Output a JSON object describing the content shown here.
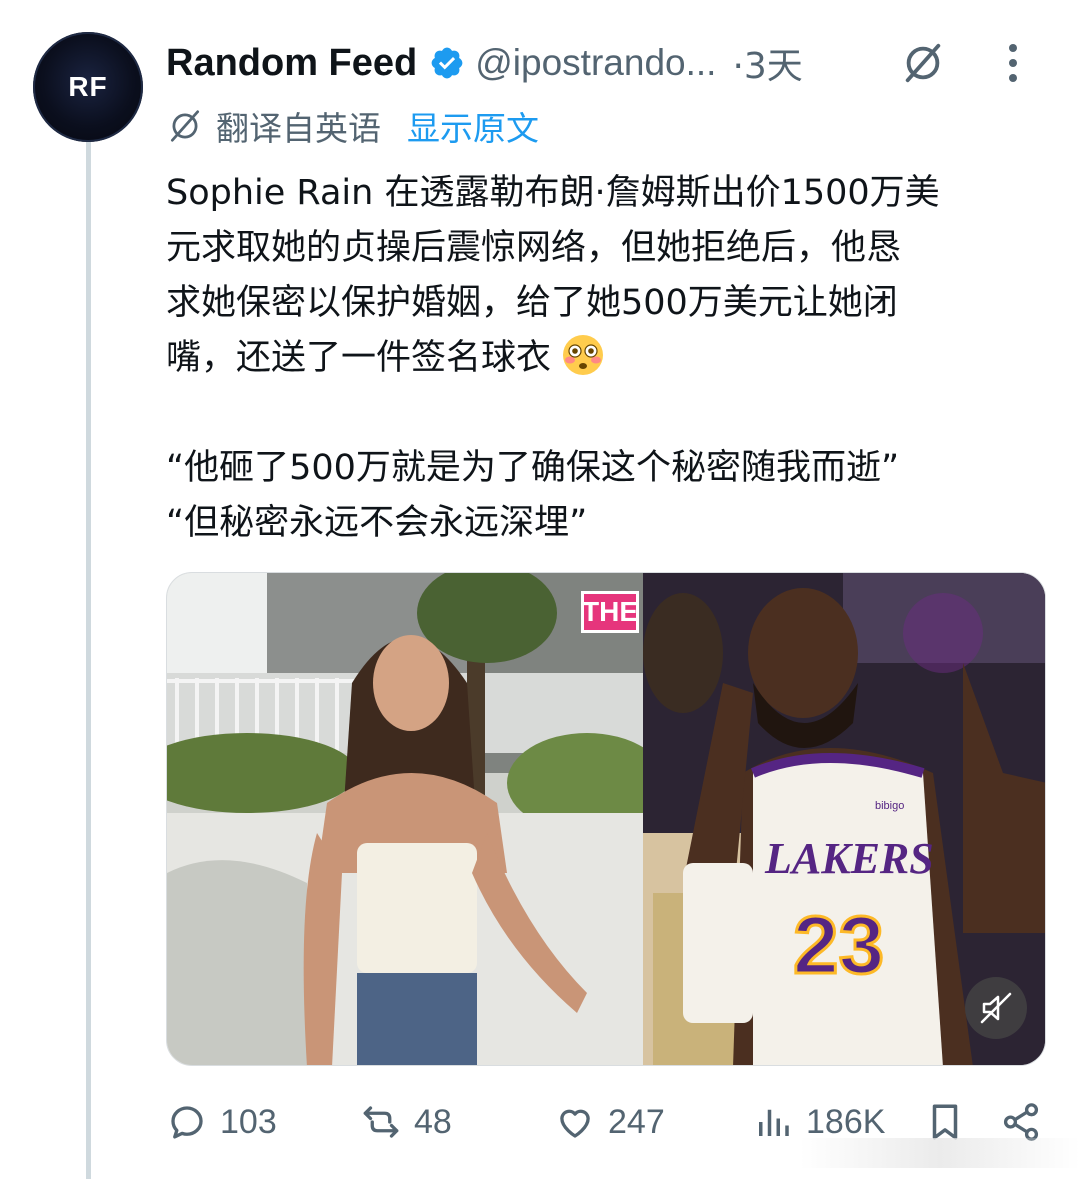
{
  "author": {
    "avatar_text": "RF",
    "name": "Random Feed",
    "handle": "@ipostrando...",
    "time": "·3天"
  },
  "translation": {
    "label": "翻译自英语",
    "show_original": "显示原文"
  },
  "tweet": {
    "line1": "Sophie Rain 在透露勒布朗·詹姆斯出价1500万美",
    "line2": "元求取她的贞操后震惊网络，但她拒绝后，他恳",
    "line3": "求她保密以保护婚姻，给了她500万美元让她闭",
    "line4": "嘴，还送了一件签名球衣",
    "quote1": "“他砸了500万就是为了确保这个秘密随我而逝”",
    "quote2": "“但秘密永远不会永远深埋”"
  },
  "media": {
    "left_badge": "THE",
    "jersey_text": "LAKERS",
    "jersey_number": "23",
    "sponsor": "bibigo"
  },
  "actions": {
    "replies": "103",
    "reposts": "48",
    "likes": "247",
    "views": "186K"
  },
  "colors": {
    "accent": "#1d9bf0",
    "secondary_text": "#536471",
    "lakers_purple": "#552583",
    "lakers_gold": "#fdb927"
  }
}
